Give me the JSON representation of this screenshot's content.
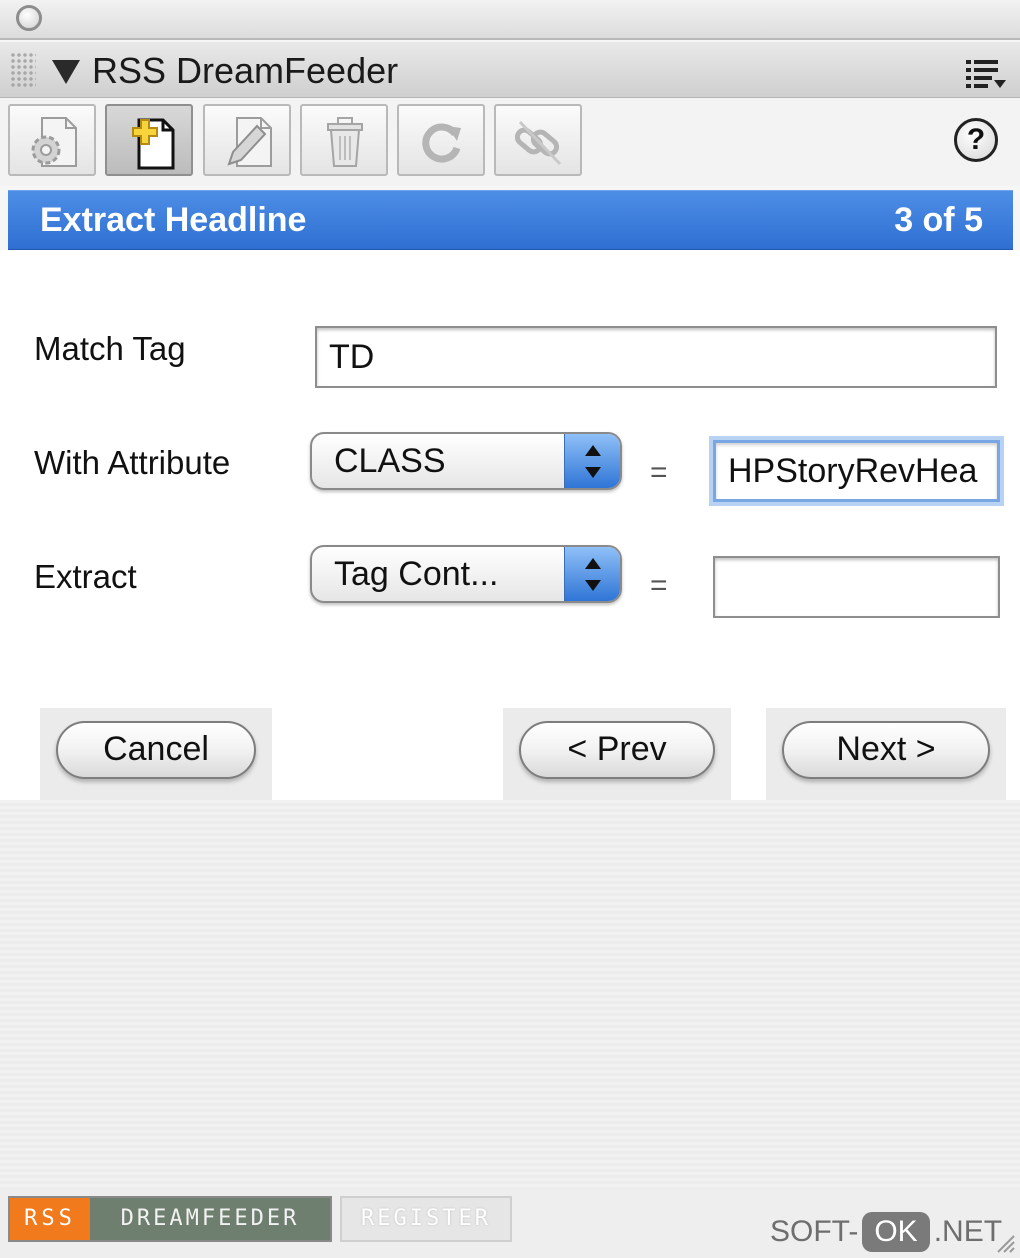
{
  "panel": {
    "title": "RSS DreamFeeder"
  },
  "toolbar": {
    "icons": [
      "settings-doc-icon",
      "new-doc-icon",
      "edit-doc-icon",
      "trash-icon",
      "refresh-icon",
      "link-icon"
    ],
    "help_label": "?"
  },
  "step": {
    "title": "Extract Headline",
    "count": "3 of 5"
  },
  "form": {
    "match_tag_label": "Match Tag",
    "match_tag_value": "TD",
    "with_attribute_label": "With Attribute",
    "attribute_select": "CLASS",
    "attribute_equals": "=",
    "attribute_value": "HPStoryRevHea",
    "extract_label": "Extract",
    "extract_select": "Tag Cont...",
    "extract_equals": "=",
    "extract_value": ""
  },
  "buttons": {
    "cancel": "Cancel",
    "prev": "< Prev",
    "next": "Next >"
  },
  "footer": {
    "logo_rss": "RSS",
    "logo_name": "DREAMFEEDER",
    "register": "REGISTER"
  },
  "watermark": {
    "prefix": "SOFT-",
    "ok": "OK",
    "suffix": ".NET"
  },
  "colors": {
    "step_bar": "#3a7ddc",
    "logo_orange": "#f07a1c",
    "logo_green": "#6f7f6f",
    "popup_arrow_blue": "#2f75d6"
  }
}
